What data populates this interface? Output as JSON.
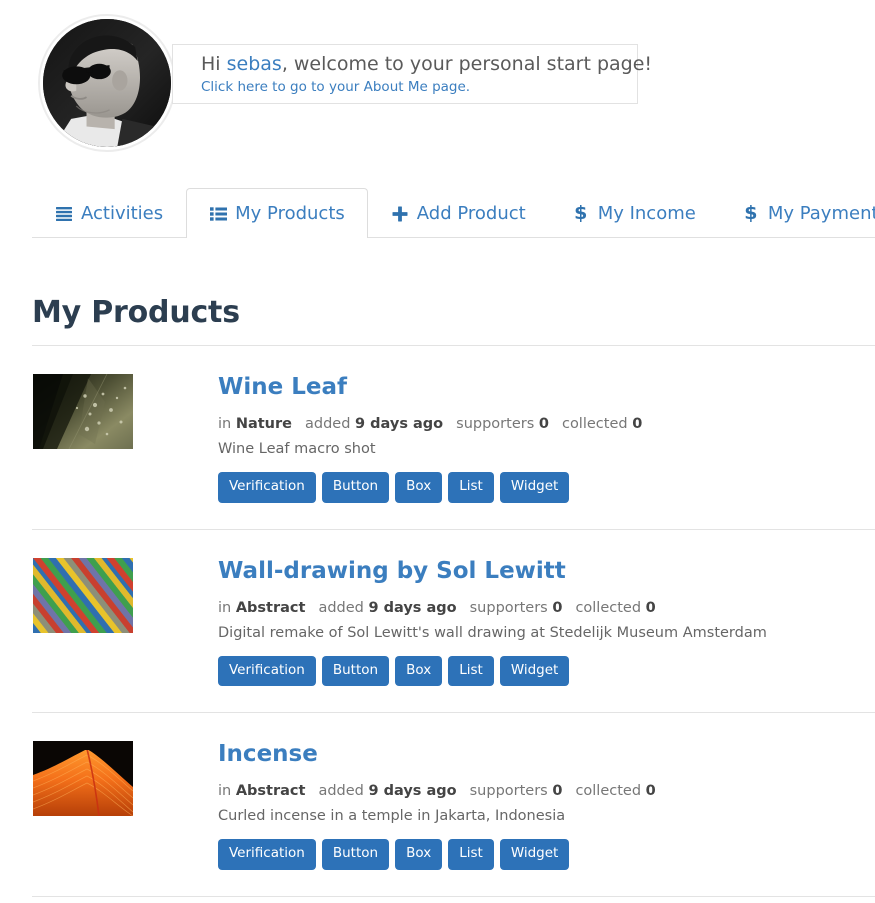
{
  "header": {
    "avatar_alt": "user-avatar-photo",
    "greeting_prefix": "Hi ",
    "username": "sebas",
    "greeting_suffix": ", welcome to your personal start page!",
    "about_link": "Click here to go to your About Me page."
  },
  "tabs": [
    {
      "label": "Activities",
      "icon": "bars-icon",
      "active": false
    },
    {
      "label": "My Products",
      "icon": "list-ul-icon",
      "active": true
    },
    {
      "label": "Add Product",
      "icon": "plus-icon",
      "active": false
    },
    {
      "label": "My Income",
      "icon": "dollar-icon",
      "active": false
    },
    {
      "label": "My Payments",
      "icon": "dollar-icon",
      "active": false
    }
  ],
  "main": {
    "title": "My Products",
    "meta_labels": {
      "in": "in",
      "added": "added",
      "supporters": "supporters",
      "collected": "collected"
    },
    "products": [
      {
        "title": "Wine Leaf",
        "category": "Nature",
        "added": "9 days ago",
        "supporters": "0",
        "collected": "0",
        "description": "Wine Leaf macro shot",
        "thumbnail": "wine-leaf-macro-thumbnail",
        "buttons": [
          "Verification",
          "Button",
          "Box",
          "List",
          "Widget"
        ]
      },
      {
        "title": "Wall-drawing by Sol Lewitt",
        "category": "Abstract",
        "added": "9 days ago",
        "supporters": "0",
        "collected": "0",
        "description": "Digital remake of Sol Lewitt's wall drawing at Stedelijk Museum Amsterdam",
        "thumbnail": "diagonal-color-stripes-thumbnail",
        "buttons": [
          "Verification",
          "Button",
          "Box",
          "List",
          "Widget"
        ]
      },
      {
        "title": "Incense",
        "category": "Abstract",
        "added": "9 days ago",
        "supporters": "0",
        "collected": "0",
        "description": "Curled incense in a temple in Jakarta, Indonesia",
        "thumbnail": "orange-incense-thumbnail",
        "buttons": [
          "Verification",
          "Button",
          "Box",
          "List",
          "Widget"
        ]
      }
    ]
  },
  "colors": {
    "link": "#3b7ebf",
    "button": "#2d72b8",
    "title": "#2c3e50",
    "divider": "#e3e3e3"
  }
}
